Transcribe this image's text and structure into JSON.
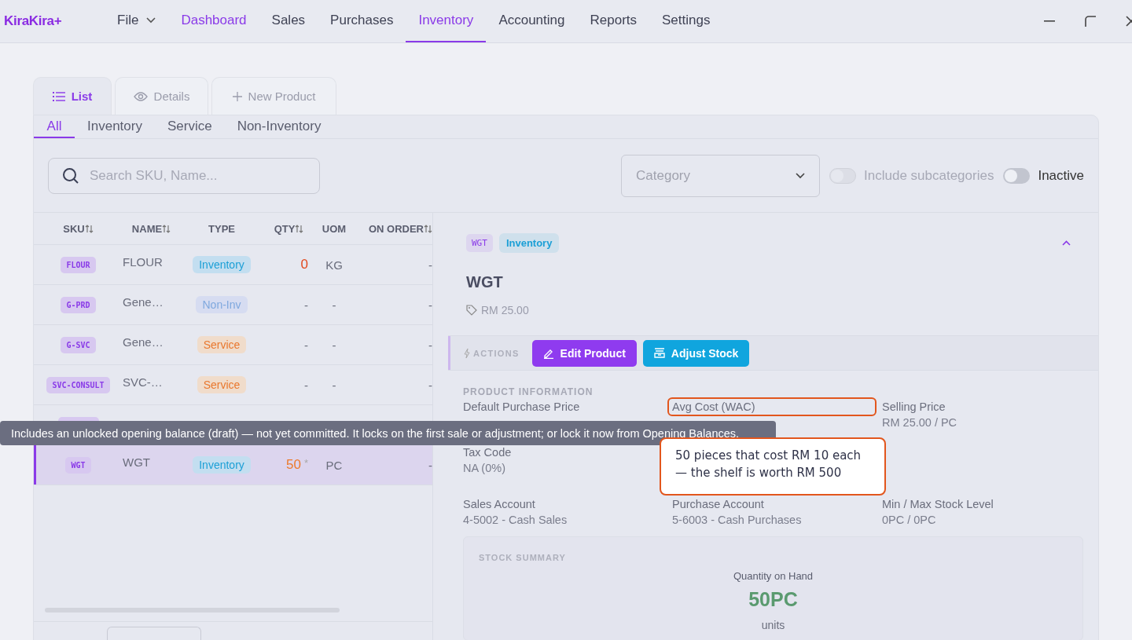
{
  "app": {
    "logo": "KiraKira+"
  },
  "menu": [
    {
      "label": "File",
      "kind": "dropdown",
      "selected": false,
      "hovered": false
    },
    {
      "label": "Dashboard",
      "kind": "link",
      "selected": false,
      "hovered": true
    },
    {
      "label": "Sales",
      "kind": "link",
      "selected": false,
      "hovered": false
    },
    {
      "label": "Purchases",
      "kind": "link",
      "selected": false,
      "hovered": false
    },
    {
      "label": "Inventory",
      "kind": "link",
      "selected": true,
      "hovered": false
    },
    {
      "label": "Accounting",
      "kind": "link",
      "selected": false,
      "hovered": false
    },
    {
      "label": "Reports",
      "kind": "link",
      "selected": false,
      "hovered": false
    },
    {
      "label": "Settings",
      "kind": "link",
      "selected": false,
      "hovered": false
    }
  ],
  "view_tabs": [
    {
      "label": "List",
      "kind": "list",
      "selected": true
    },
    {
      "label": "Details",
      "kind": "details",
      "selected": false
    },
    {
      "label": "New Product",
      "kind": "new",
      "selected": false
    }
  ],
  "filter_tabs": [
    {
      "label": "All",
      "selected": true
    },
    {
      "label": "Inventory",
      "selected": false
    },
    {
      "label": "Service",
      "selected": false
    },
    {
      "label": "Non-Inventory",
      "selected": false
    }
  ],
  "search": {
    "placeholder": "Search SKU, Name..."
  },
  "category": {
    "placeholder": "Category"
  },
  "toggles": [
    {
      "label": "Include subcategories",
      "on": false,
      "disabled": true
    },
    {
      "label": "Inactive",
      "on": false,
      "disabled": false
    }
  ],
  "table": {
    "columns": [
      {
        "label": "SKU",
        "sortable": true
      },
      {
        "label": "NAME",
        "sortable": true
      },
      {
        "label": "TYPE",
        "sortable": false
      },
      {
        "label": "QTY",
        "sortable": true
      },
      {
        "label": "UOM",
        "sortable": false
      },
      {
        "label": "ON ORDER",
        "sortable": true
      }
    ],
    "rows": [
      {
        "sku": "FLOUR",
        "name": "FLOUR",
        "type": {
          "label": "Inventory",
          "kind": "inventory"
        },
        "qty": "0",
        "color": "#e2481d",
        "uom": "KG",
        "on_order": "-",
        "selected": false
      },
      {
        "sku": "G-PRD",
        "name": "Gene…",
        "type": {
          "label": "Non-Inv",
          "kind": "non-inventory"
        },
        "qty": "-",
        "uom": "-",
        "on_order": "-",
        "selected": false
      },
      {
        "sku": "G-SVC",
        "name": "Gene…",
        "type": {
          "label": "Service",
          "kind": "service"
        },
        "qty": "-",
        "uom": "-",
        "on_order": "-",
        "selected": false
      },
      {
        "sku": "SVC-CONSULT",
        "name": "SVC-…",
        "type": {
          "label": "Service",
          "kind": "service"
        },
        "qty": "-",
        "uom": "-",
        "on_order": "-",
        "selected": false
      },
      {
        "selected": false
      },
      {
        "sku": "WGT",
        "name": "WGT",
        "type": {
          "label": "Inventory",
          "kind": "inventory"
        },
        "qty": "50",
        "qty_note": "*",
        "color": "#ec7a2b",
        "uom": "PC",
        "on_order": "-",
        "selected": true
      }
    ]
  },
  "tooltip": "Includes an unlocked opening balance (draft) — not yet committed. It locks on the first sale or adjustment; or lock it now from Opening Balances.",
  "detail": {
    "sku": "WGT",
    "type": {
      "label": "Inventory",
      "kind": "inventory"
    },
    "title": "WGT",
    "price": "RM 25.00",
    "actions_label": "ACTIONS",
    "actions": [
      {
        "label": "Edit Product",
        "kind": "edit"
      },
      {
        "label": "Adjust Stock",
        "kind": "stock"
      }
    ],
    "section": "PRODUCT INFORMATION",
    "field_rows": [
      [
        {
          "label": "Default Purchase Price"
        },
        {
          "label": "Avg Cost (WAC)",
          "highlighted": true
        },
        {
          "label": "Selling Price",
          "value": "RM 25.00 / PC"
        }
      ],
      [
        {
          "label": "Tax Code",
          "value": "NA (0%)"
        }
      ],
      [
        {
          "label": "Sales Account",
          "value": "4-5002 - Cash Sales"
        },
        {
          "label": "Purchase Account",
          "value": "5-6003 - Cash Purchases"
        },
        {
          "label": "Min / Max Stock Level",
          "value": "0PC / 0PC"
        }
      ]
    ],
    "stock_summary": {
      "title": "STOCK SUMMARY",
      "label": "Quantity on Hand",
      "value": "50PC",
      "unit": "units"
    }
  },
  "callout": [
    "50 pieces that cost RM 10 each",
    "— the shelf is worth RM 500"
  ]
}
